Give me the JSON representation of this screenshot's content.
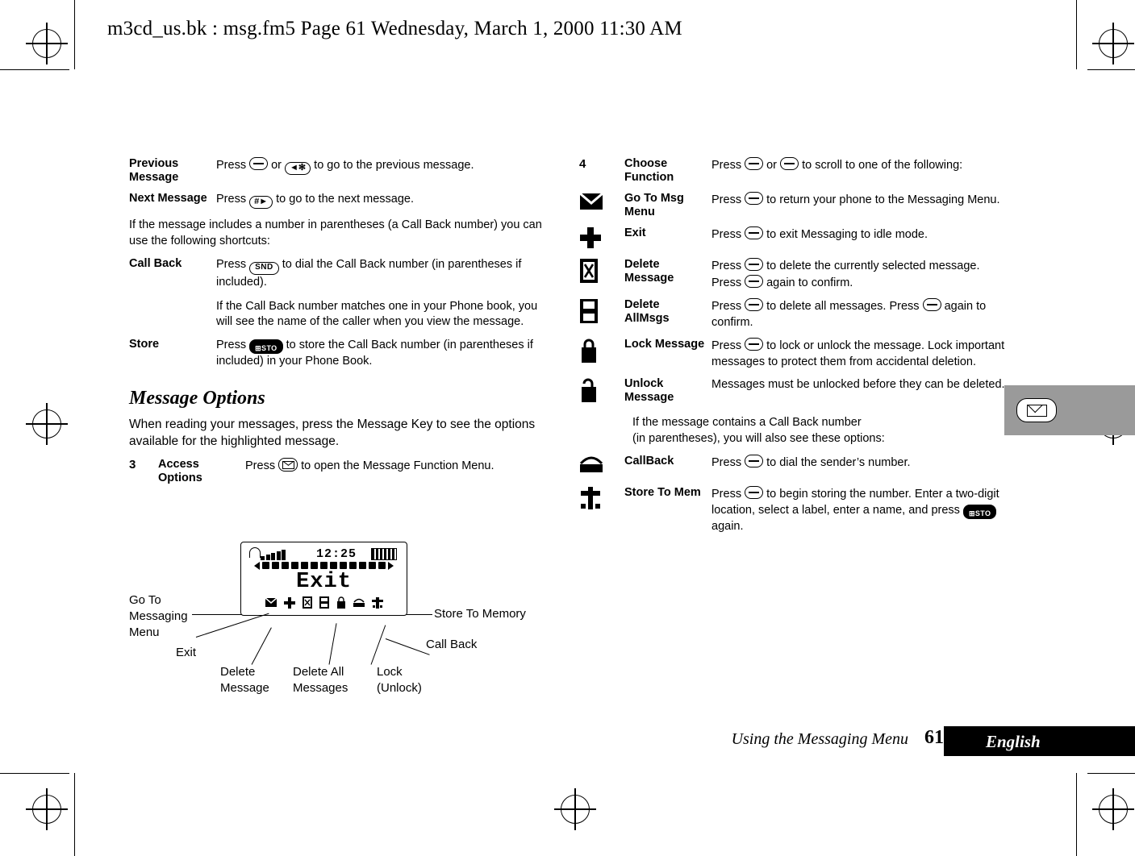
{
  "header": {
    "text": "m3cd_us.bk : msg.fm5  Page 61  Wednesday, March 1, 2000  11:30 AM"
  },
  "left_column": {
    "rows_top": [
      {
        "term": "Previous Message",
        "desc_prefix": "Press ",
        "desc_mid": " or ",
        "desc_suffix": " to go to the previous message.",
        "keys": [
          "volume-rocker",
          "star-key"
        ]
      },
      {
        "term": "Next Message",
        "desc_prefix": "Press ",
        "desc_suffix": " to go to the next message.",
        "keys": [
          "hash-key"
        ]
      }
    ],
    "note": "If the message includes a number in parentheses (a Call Back number) you can use the following shortcuts:",
    "rows_shortcuts": [
      {
        "term": "Call Back",
        "desc_prefix": "Press ",
        "desc_suffix": " to dial the Call Back number (in parentheses if included).",
        "keys": [
          "snd-key"
        ],
        "extra": "If the Call Back number matches one in your Phone book, you will see the name of the caller when you view the message."
      },
      {
        "term": "Store",
        "desc_prefix": "Press ",
        "desc_suffix": " to store the Call Back number (in parentheses if included) in your Phone Book.",
        "keys": [
          "sto-key"
        ]
      }
    ],
    "section_title": "Message Options",
    "section_intro": "When reading your messages, press the Message Key to see the options available for the highlighted message.",
    "step3": {
      "number": "3",
      "term": "Access Options",
      "desc_prefix": "Press ",
      "desc_suffix": " to open the Message Function Menu.",
      "keys": [
        "msg-key"
      ]
    }
  },
  "figure": {
    "display": {
      "time": "12:25",
      "word": "Exit"
    },
    "callouts": {
      "go_to_messaging_menu": "Go To\nMessaging\nMenu",
      "exit": "Exit",
      "delete_message": "Delete\nMessage",
      "delete_all_messages": "Delete All\nMessages",
      "lock_unlock": "Lock\n(Unlock)",
      "store_to_memory": "Store To Memory",
      "call_back": "Call Back"
    }
  },
  "right_column": {
    "step4": {
      "number": "4",
      "term": "Choose Function",
      "desc_prefix": "Press ",
      "desc_mid": " or ",
      "desc_suffix": " to scroll to one of the following:",
      "keys": [
        "volume-up",
        "volume-down"
      ]
    },
    "rows": [
      {
        "icon": "go-to-msg-menu-icon",
        "term": "Go To Msg Menu",
        "desc_prefix": "Press ",
        "desc_suffix": " to return your phone to the Messaging Menu.",
        "keys": [
          "select-key"
        ]
      },
      {
        "icon": "exit-icon",
        "term": "Exit",
        "desc_prefix": "Press ",
        "desc_suffix": " to exit Messaging to idle mode.",
        "keys": [
          "select-key"
        ]
      },
      {
        "icon": "delete-message-icon",
        "term": "Delete Message",
        "desc_prefix": "Press ",
        "desc_mid": " to delete the currently selected message. Press ",
        "desc_suffix": " again to confirm.",
        "keys": [
          "select-key",
          "select-key"
        ]
      },
      {
        "icon": "delete-all-msgs-icon",
        "term": "Delete AllMsgs",
        "desc_prefix": "Press ",
        "desc_mid": " to delete all messages. Press ",
        "desc_suffix": " again to confirm.",
        "keys": [
          "select-key",
          "select-key"
        ]
      },
      {
        "icon": "lock-message-icon",
        "term": "Lock Message",
        "desc_prefix": "Press ",
        "desc_suffix": " to lock or unlock the message. Lock important messages to protect them from accidental deletion.",
        "keys": [
          "select-key"
        ]
      },
      {
        "icon": "unlock-message-icon",
        "term": "Unlock Message",
        "desc_plain": "Messages must be unlocked before they can be deleted."
      }
    ],
    "note": "If the message contains a Call Back number\n(in parentheses), you will also see these options:",
    "rows2": [
      {
        "icon": "call-back-icon",
        "term": "CallBack",
        "desc_prefix": "Press ",
        "desc_suffix": " to dial the sender’s number.",
        "keys": [
          "select-key"
        ]
      },
      {
        "icon": "store-to-mem-icon",
        "term": "Store To Mem",
        "desc_prefix": "Press ",
        "desc_mid": " to begin storing the number. Enter a two-digit location, select a label, enter a name, and press ",
        "desc_suffix": " again.",
        "keys": [
          "select-key",
          "sto-key"
        ]
      }
    ]
  },
  "footer": {
    "title": "Using the Messaging Menu",
    "page": "61",
    "language": "English"
  },
  "colors": {
    "ink": "#000000",
    "paper": "#ffffff",
    "tab_gray": "#9a9a9a"
  }
}
